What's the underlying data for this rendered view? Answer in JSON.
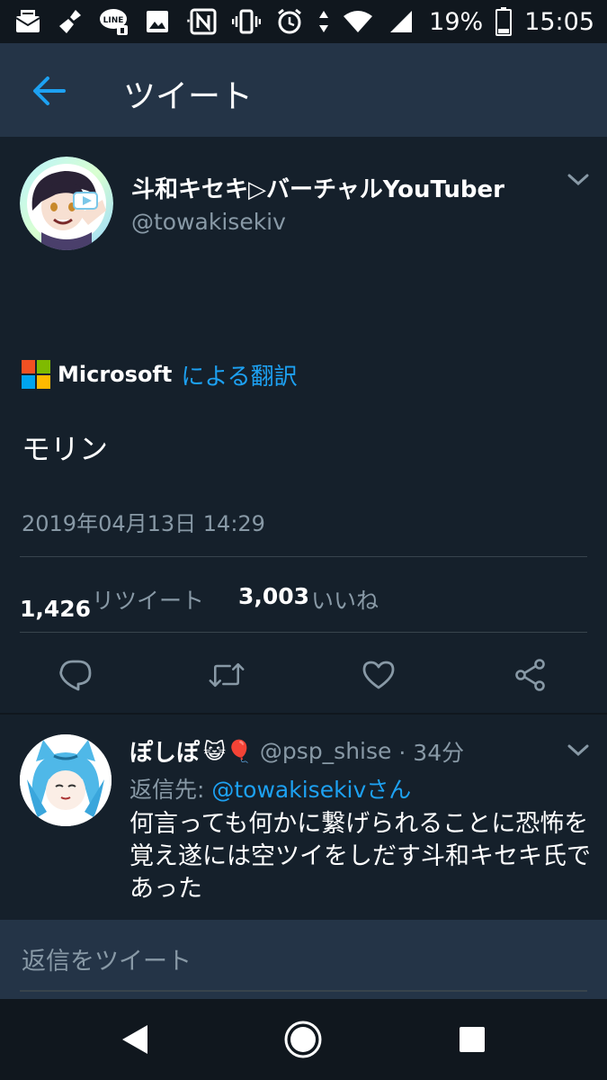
{
  "status_bar": {
    "battery": "19%",
    "time": "15:05",
    "dots": "· ·",
    "icons": [
      "mail-icon",
      "broom-icon",
      "line-icon",
      "image-icon",
      "nfc-icon",
      "vibrate-icon",
      "alarm-icon",
      "data-arrows-icon",
      "wifi-icon",
      "signal-icon",
      "battery-icon"
    ]
  },
  "header": {
    "title": "ツイート",
    "back_icon": "arrow-left-icon"
  },
  "tweet": {
    "display_name": "斗和キセキ▷バーチャルYouTuber",
    "handle": "@towakisekiv",
    "translation": {
      "provider": "Microsoft",
      "by_text": "による翻訳"
    },
    "text": "モリン",
    "timestamp": "2019年04月13日 14:29",
    "stats": {
      "retweets": "1,426",
      "retweets_label": "リツイート",
      "likes": "3,003",
      "likes_label": "いいね"
    },
    "actions": [
      "reply-icon",
      "retweet-icon",
      "like-icon",
      "share-icon"
    ]
  },
  "reply": {
    "display_name": "ぽしぽ",
    "emoji": "😺🎈",
    "handle": "@psp_shise",
    "time": "· 34分",
    "reply_to_prefix": "返信先: ",
    "reply_to_handle": "@towakisekivさん",
    "body": "何言っても何かに繋げられることに恐怖を覚え遂には空ツイをしだす斗和キセキ氏であった"
  },
  "composer": {
    "placeholder": "返信をツイート"
  },
  "colors": {
    "background": "#15202b",
    "header": "#243447",
    "accent": "#1da1f2",
    "muted": "#8899a6"
  }
}
